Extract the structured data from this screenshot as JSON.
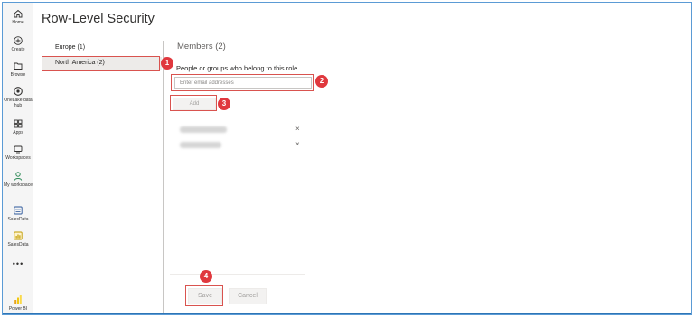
{
  "colors": {
    "rail_bg": "#f5f5f5",
    "highlight": "#d9534f",
    "badge": "#e0383e",
    "accent_green": "#2e8b57",
    "powerbi_yellow": "#f2c811"
  },
  "nav": {
    "items": [
      {
        "label": "Home",
        "icon": "home-icon"
      },
      {
        "label": "Create",
        "icon": "create-icon"
      },
      {
        "label": "Browse",
        "icon": "browse-icon"
      },
      {
        "label": "OneLake data hub",
        "icon": "onelake-icon"
      },
      {
        "label": "Apps",
        "icon": "apps-icon"
      },
      {
        "label": "Workspaces",
        "icon": "workspaces-icon"
      },
      {
        "label": "My workspace",
        "icon": "person-icon"
      },
      {
        "label": "SalesData",
        "icon": "dataset-icon"
      },
      {
        "label": "SalesData",
        "icon": "report-icon"
      }
    ],
    "more": "•••",
    "product": "Power BI"
  },
  "page": {
    "title": "Row-Level Security"
  },
  "roles": [
    {
      "label": "Europe (1)"
    },
    {
      "label": "North America (2)"
    }
  ],
  "members": {
    "title": "Members (2)",
    "label": "People or groups who belong to this role",
    "input_placeholder": "Enter email addresses",
    "add_label": "Add",
    "remove_symbol": "×"
  },
  "footer": {
    "save_label": "Save",
    "cancel_label": "Cancel"
  },
  "callouts": [
    "1",
    "2",
    "3",
    "4"
  ]
}
